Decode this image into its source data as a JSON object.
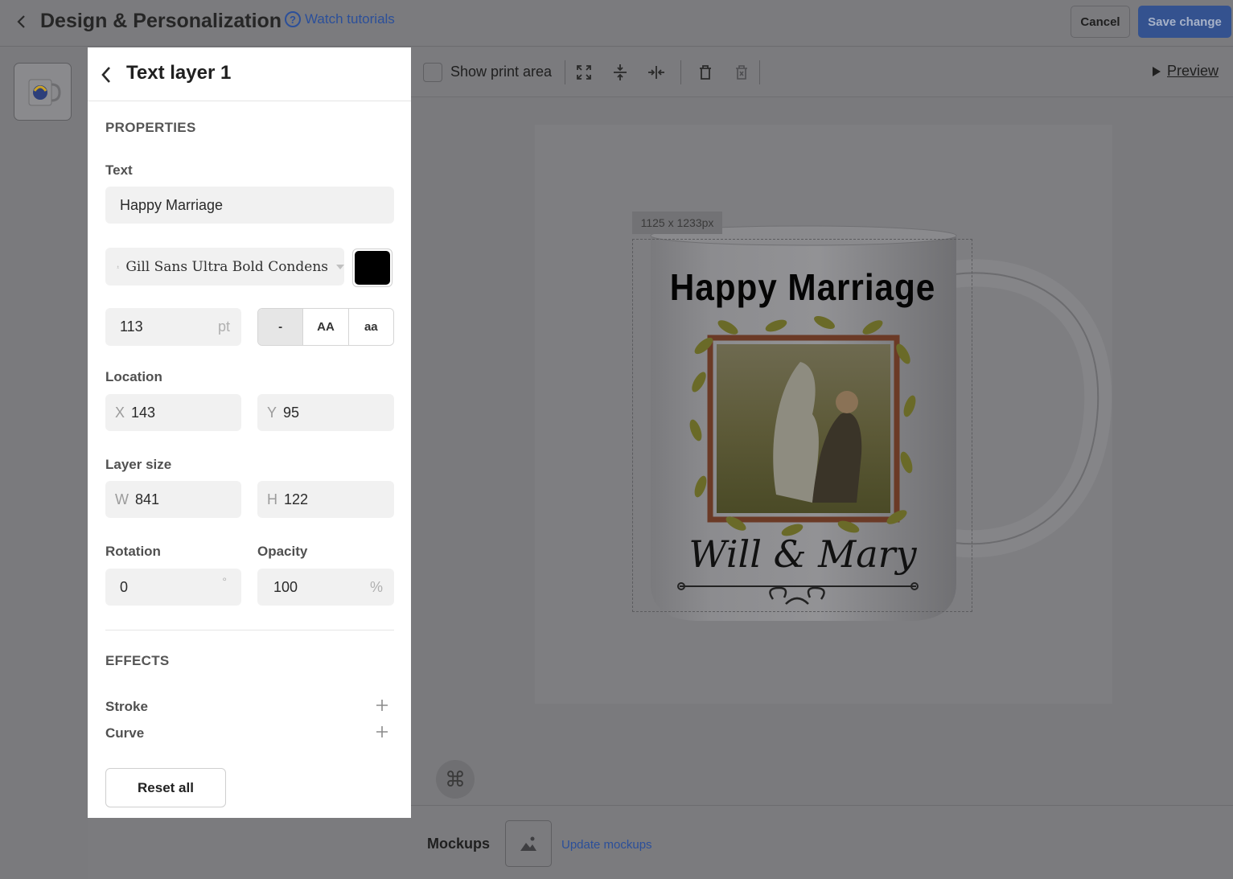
{
  "header": {
    "title": "Design & Personalization",
    "tutorials_label": "Watch tutorials",
    "cancel_label": "Cancel",
    "save_label": "Save change"
  },
  "panel": {
    "title": "Text layer 1",
    "properties_caption": "PROPERTIES",
    "text_label": "Text",
    "text_value": "Happy Marriage",
    "font_value": "Gill Sans Ultra Bold Condens",
    "text_color": "#000000",
    "font_size": "113",
    "font_size_unit": "pt",
    "case_options": [
      "-",
      "AA",
      "aa"
    ],
    "location_label": "Location",
    "x_prefix": "X",
    "x_value": "143",
    "y_prefix": "Y",
    "y_value": "95",
    "layer_size_label": "Layer size",
    "w_prefix": "W",
    "w_value": "841",
    "h_prefix": "H",
    "h_value": "122",
    "rotation_label": "Rotation",
    "rotation_value": "0",
    "rotation_unit": "°",
    "opacity_label": "Opacity",
    "opacity_value": "100",
    "opacity_unit": "%",
    "effects_caption": "EFFECTS",
    "stroke_label": "Stroke",
    "curve_label": "Curve",
    "reset_label": "Reset all"
  },
  "toolbar": {
    "show_print_area_label": "Show print area",
    "show_print_area_checked": false,
    "preview_label": "Preview"
  },
  "canvas": {
    "dimension_badge": "1125 x 1233px",
    "mug_text_top": "Happy Marriage",
    "mug_text_bottom": "Will & Mary"
  },
  "bottom": {
    "mockups_label": "Mockups",
    "update_label": "Update mockups"
  },
  "colors": {
    "accent": "#34528f",
    "link": "#2b4f9a",
    "overlay": "#7b7b7e",
    "panel_bg": "#ffffff",
    "field_bg": "#f1f1f1"
  }
}
